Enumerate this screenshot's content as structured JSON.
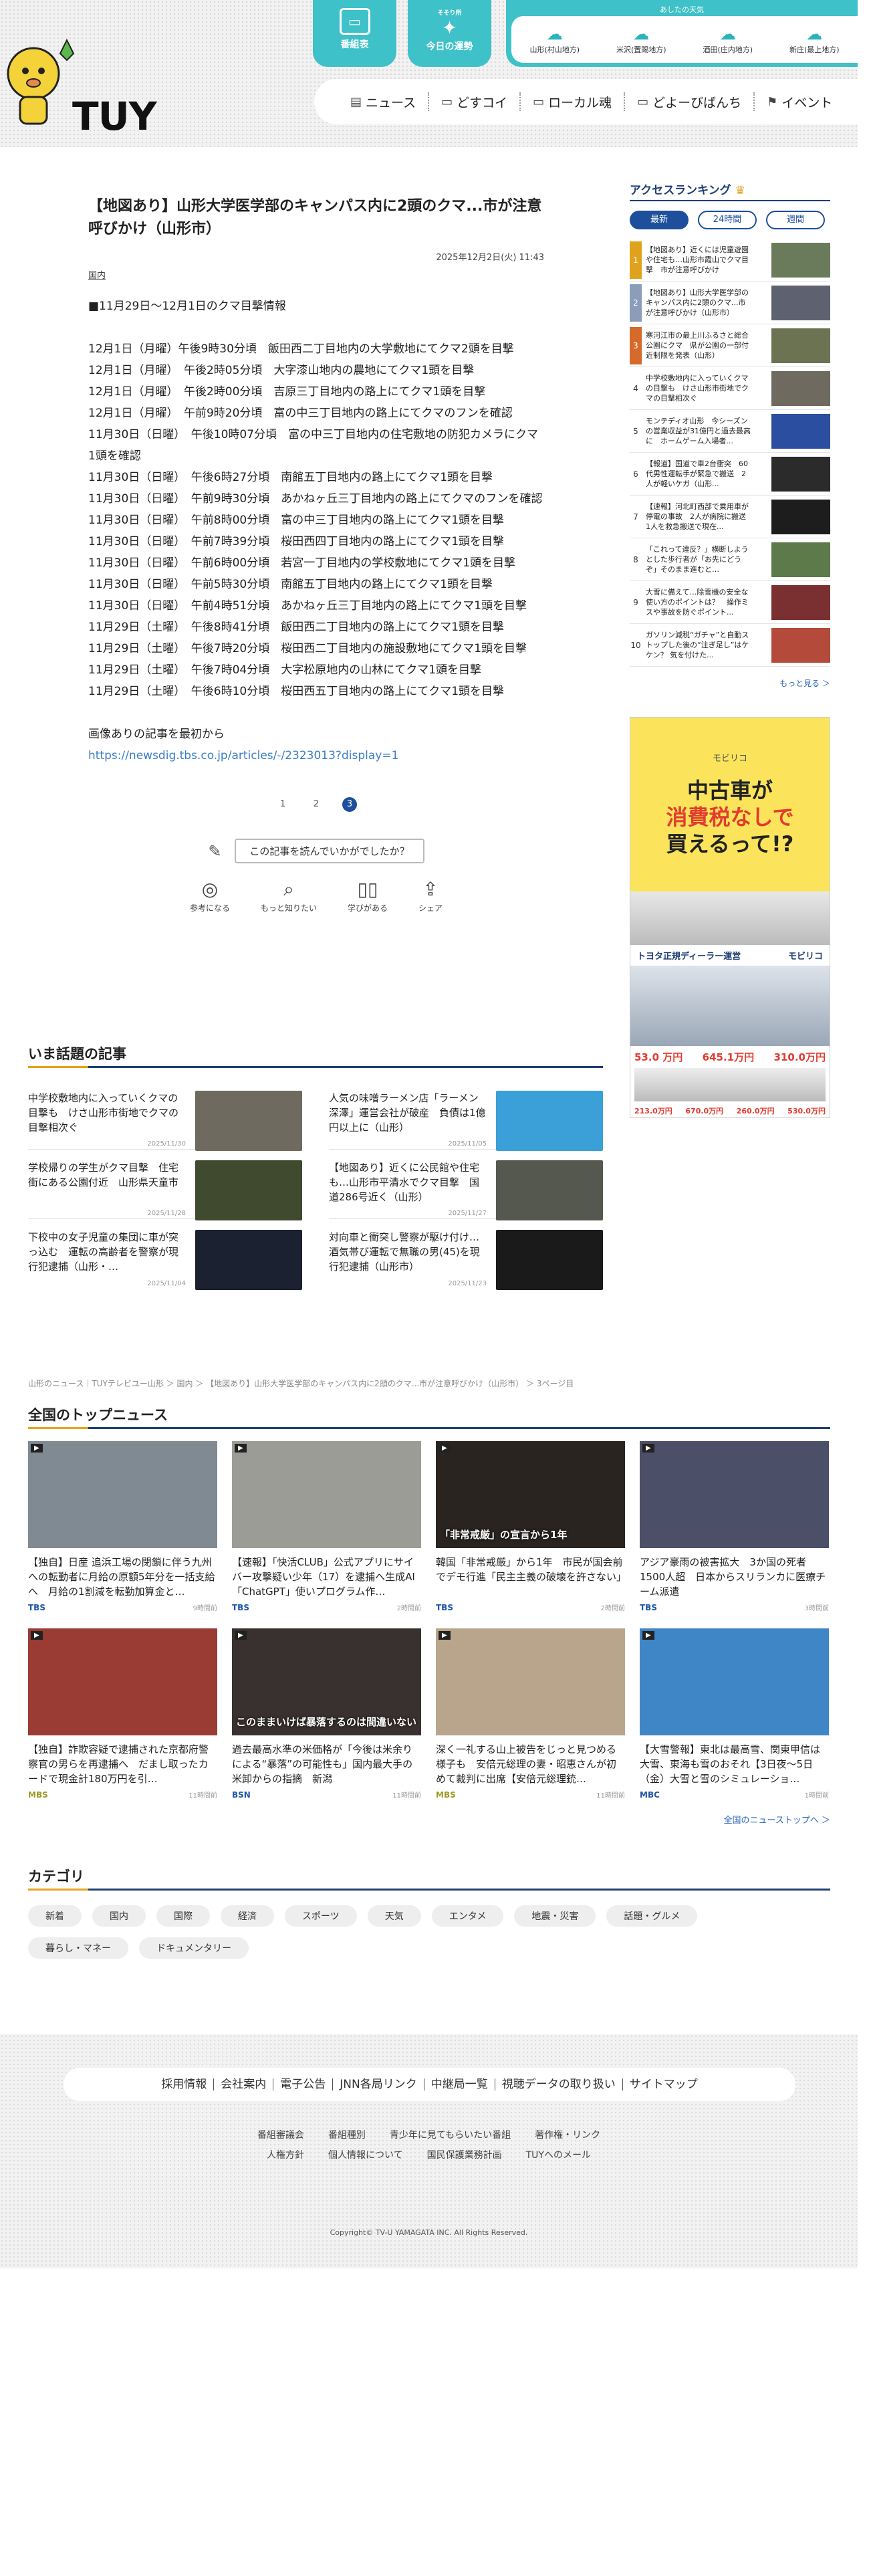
{
  "header": {
    "logo_text": "TUY",
    "btn_program": "番組表",
    "btn_fortune_small": "今日の運勢",
    "btn_fortune_top": "そそり所",
    "weather_title": "あしたの天気",
    "weather": [
      {
        "label": "山形(村山地方)"
      },
      {
        "label": "米沢(置賜地方)"
      },
      {
        "label": "酒田(庄内地方)"
      },
      {
        "label": "新庄(最上地方)"
      }
    ],
    "nav": [
      {
        "label": "ニュース"
      },
      {
        "label": "どすコイ"
      },
      {
        "label": "ローカル魂"
      },
      {
        "label": "どよーびばんち"
      },
      {
        "label": "イベント"
      }
    ]
  },
  "article": {
    "title": "【地図あり】山形大学医学部のキャンパス内に2頭のクマ...市が注意呼びかけ（山形市）",
    "date": "2025年12月2日(火) 11:43",
    "category": "国内",
    "intro": "■11月29日〜12月1日のクマ目撃情報",
    "lines": [
      "12月1日（月曜）午後9時30分頃　飯田西二丁目地内の大学敷地にてクマ2頭を目撃",
      "12月1日（月曜）　午後2時05分頃　大字漆山地内の農地にてクマ1頭を目撃",
      "12月1日（月曜）　午後2時00分頃　吉原三丁目地内の路上にてクマ1頭を目撃",
      "12月1日（月曜）　午前9時20分頃　富の中三丁目地内の路上にてクマのフンを確認",
      "11月30日（日曜）　午後10時07分頃　富の中三丁目地内の住宅敷地の防犯カメラにクマ1頭を確認",
      "11月30日（日曜）　午後6時27分頃　南館五丁目地内の路上にてクマ1頭を目撃",
      "11月30日（日曜）　午前9時30分頃　あかねヶ丘三丁目地内の路上にてクマのフンを確認",
      "11月30日（日曜）　午前8時00分頃　富の中三丁目地内の路上にてクマ1頭を目撃",
      "11月30日（日曜）　午前7時39分頃　桜田西四丁目地内の路上にてクマ1頭を目撃",
      "11月30日（日曜）　午前6時00分頃　若宮一丁目地内の学校敷地にてクマ1頭を目撃",
      "11月30日（日曜）　午前5時30分頃　南館五丁目地内の路上にてクマ1頭を目撃",
      "11月30日（日曜）　午前4時51分頃　あかねヶ丘三丁目地内の路上にてクマ1頭を目撃",
      "11月29日（土曜）　午後8時41分頃　飯田西二丁目地内の路上にてクマ1頭を目撃",
      "11月29日（土曜）　午後7時20分頃　桜田西二丁目地内の施設敷地にてクマ1頭を目撃",
      "11月29日（土曜）　午後7時04分頃　大字松原地内の山林にてクマ1頭を目撃",
      "11月29日（土曜）　午後6時10分頃　桜田西五丁目地内の路上にてクマ1頭を目撃"
    ],
    "source_text": "画像ありの記事を最初から",
    "source_url": "https://newsdig.tbs.co.jp/articles/-/2323013?display=1",
    "pages": [
      "1",
      "2",
      "3"
    ],
    "survey": "この記事を読んでいかがでしたか？",
    "reactions": [
      {
        "label": "参考になる"
      },
      {
        "label": "もっと知りたい"
      },
      {
        "label": "学びがある"
      },
      {
        "label": "シェア"
      }
    ]
  },
  "popular": {
    "heading": "いま話題の記事",
    "items": [
      {
        "title": "中学校敷地内に入っていくクマの目撃も　けさ山形市街地でクマの目撃相次ぐ",
        "time": "2025/11/30",
        "color": "#6f6a5f"
      },
      {
        "title": "人気の味噌ラーメン店「ラーメン深澤」運営会社が破産　負債は1億円以上に（山形）",
        "time": "2025/11/05",
        "color": "#3b9fd8"
      },
      {
        "title": "学校帰りの学生がクマ目撃　住宅街にある公園付近　山形県天童市",
        "time": "2025/11/28",
        "color": "#3f4a2e"
      },
      {
        "title": "【地図あり】近くに公民館や住宅も…山形市平清水でクマ目撃　国道286号近く（山形）",
        "time": "2025/11/27",
        "color": "#55584f"
      },
      {
        "title": "下校中の女子児童の集団に車が突っ込む　運転の高齢者を警察が現行犯逮捕（山形・…",
        "time": "2025/11/04",
        "color": "#1b2130"
      },
      {
        "title": "対向車と衝突し警察が駆け付け…酒気帯び運転で無職の男(45)を現行犯逮捕（山形市）",
        "time": "2025/11/23",
        "color": "#1a1a1a"
      }
    ]
  },
  "breadcrumb": "山形のニュース｜TUYテレビユー山形 ＞ 国内 ＞ 【地図あり】山形大学医学部のキャンパス内に2頭のクマ...市が注意呼びかけ（山形市） ＞ 3ページ目",
  "national": {
    "heading": "全国のトップニュース",
    "items": [
      {
        "title": "【独自】日産 追浜工場の閉鎖に伴う九州への転勤者に月給の原額5年分を一括支給へ　月給の1割減を転勤加算金と…",
        "src": "TBS",
        "time": "9時間前",
        "color": "#7f8a93",
        "cap": ""
      },
      {
        "title": "【速報】「快活CLUB」公式アプリにサイバー攻撃疑い少年（17）を逮捕へ生成AI「ChatGPT」使いプログラム作…",
        "src": "TBS",
        "time": "2時間前",
        "color": "#9c9c96",
        "cap": ""
      },
      {
        "title": "韓国「非常戒厳」から1年　市民が国会前でデモ行進「民主主義の破壊を許さない」",
        "src": "TBS",
        "time": "2時間前",
        "color": "#2a2420",
        "cap": "「非常戒厳」の宣言から1年"
      },
      {
        "title": "アジア豪雨の被害拡大　3か国の死者1500人超　日本からスリランカに医療チーム派遣",
        "src": "TBS",
        "time": "3時間前",
        "color": "#4b4f67",
        "cap": ""
      },
      {
        "title": "【独自】詐欺容疑で逮捕された京都府警察官の男らを再逮捕へ　だまし取ったカードで現金計180万円を引…",
        "src": "MBS",
        "time": "11時間前",
        "color": "#9a3b34",
        "cap": ""
      },
      {
        "title": "過去最高水準の米価格が「今後は米余りによる“暴落”の可能性も」国内最大手の米卸からの指摘　新潟",
        "src": "BSN",
        "time": "11時間前",
        "color": "#39312f",
        "cap": "このままいけば暴落するのは間違いない"
      },
      {
        "title": "深く一礼する山上被告をじっと見つめる様子も　安倍元総理の妻・昭恵さんが初めて裁判に出席【安倍元総理銃…",
        "src": "MBS",
        "time": "11時間前",
        "color": "#b8a58b",
        "cap": ""
      },
      {
        "title": "【大雪警報】東北は最高雪、関東甲信は大雪、東海も雪のおそれ【3日夜〜5日（金）大雪と雪のシミュレーショ…",
        "src": "MBC",
        "time": "1時間前",
        "color": "#3f86c7",
        "cap": ""
      }
    ],
    "more": "全国のニューストップへ ＞"
  },
  "category": {
    "heading": "カテゴリ",
    "tags": [
      "新着",
      "国内",
      "国際",
      "経済",
      "スポーツ",
      "天気",
      "エンタメ",
      "地震・災害",
      "話題・グルメ",
      "暮らし・マネー",
      "ドキュメンタリー"
    ]
  },
  "sidebar": {
    "heading": "アクセスランキング",
    "tabs": [
      "最新",
      "24時間",
      "週間"
    ],
    "items": [
      {
        "rank": "1",
        "title": "【地図あり】近くには児童遊園や住宅も…山形市霞山でクマ目撃　市が注意呼びかけ",
        "color": "#6a7b5b"
      },
      {
        "rank": "2",
        "title": "【地図あり】山形大学医学部のキャンパス内に2頭のクマ...市が注意呼びかけ（山形市）",
        "color": "#5e6270"
      },
      {
        "rank": "3",
        "title": "寒河江市の最上川ふるさと総合公園にクマ　県が公園の一部付近制限を発表（山形）",
        "color": "#6b7353"
      },
      {
        "rank": "4",
        "title": "中学校敷地内に入っていくクマの目撃も　けさ山形市街地でクマの目撃相次ぐ",
        "color": "#6f6a5f"
      },
      {
        "rank": "5",
        "title": "モンテディオ山形　今シーズンの営業収益が31億円と過去最高に　ホームゲーム入場者...",
        "color": "#2c4ea0"
      },
      {
        "rank": "6",
        "title": "【報道】国道で車2台衝突　60代男性運転手が緊急で搬送　2人が軽いケガ（山形...",
        "color": "#2b2b2b"
      },
      {
        "rank": "7",
        "title": "【速報】河北町西部で乗用車が停電の事故　2人が病院に搬送　1人を救急搬送で現在...",
        "color": "#1d1d1d"
      },
      {
        "rank": "8",
        "title": "「これって違反？」横断しようとした歩行者が「お先にどうぞ」そのまま進むと…",
        "color": "#5c7a4a"
      },
      {
        "rank": "9",
        "title": "大雪に備えて…除雪機の安全な使い方のポイントは？　操作ミスや事故を防ぐポイント...",
        "color": "#7a3030"
      },
      {
        "rank": "10",
        "title": "ガソリン減税“ガチャ”と自動ストップした後の“注ぎ足し”はケケン？ 気を付けた...",
        "color": "#b34a3a"
      }
    ],
    "more": "もっと見る ＞",
    "ad": {
      "logo": "モビリコ",
      "headline_1": "中古車が",
      "headline_2": "消費税なしで",
      "headline_3": "買えるって!?",
      "brand": "トヨタ正規ディーラー運営",
      "brand_right": "モビリコ",
      "prices": [
        "645.1万円",
        "53.0 万円",
        "310.0万円",
        "213.0万円",
        "670.0万円",
        "260.0万円",
        "530.0万円"
      ]
    }
  },
  "footer": {
    "links": [
      "採用情報",
      "会社案内",
      "電子公告",
      "JNN各局リンク",
      "中継局一覧",
      "視聴データの取り扱い",
      "サイトマップ"
    ],
    "sub1": [
      "番組審議会",
      "番組種別",
      "青少年に見てもらいたい番組",
      "著作権・リンク"
    ],
    "sub2": [
      "人権方針",
      "個人情報について",
      "国民保護業務計画",
      "TUYへのメール"
    ],
    "copyright": "Copyright© TV-U YAMAGATA INC. All Rights Reserved."
  }
}
